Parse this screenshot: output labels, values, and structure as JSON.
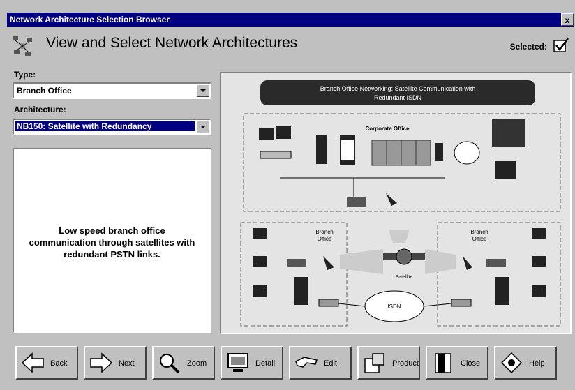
{
  "window": {
    "title": "Network Architecture Selection Browser",
    "close_glyph": "x"
  },
  "header": {
    "title": "View and Select Network Architectures",
    "selected_label": "Selected:"
  },
  "type": {
    "label": "Type:",
    "value": "Branch Office"
  },
  "architecture": {
    "label": "Architecture:",
    "value": "NB150: Satellite with Redundancy"
  },
  "description": "Low speed branch office communication through satellites with redundant PSTN links.",
  "diagram": {
    "banner": [
      "Branch Office Networking: Satellite Communication with",
      "Redundant ISDN"
    ],
    "corporate_office": "Corporate Office",
    "branch_office_left": [
      "Branch",
      "Office"
    ],
    "branch_office_right": [
      "Branch",
      "Office"
    ],
    "isdn": "ISDN",
    "satellite": "Satellite"
  },
  "toolbar": {
    "back": "Back",
    "next": "Next",
    "zoom": "Zoom",
    "detail": "Detail",
    "edit": "Edit",
    "product": "Product",
    "close": "Close",
    "help": "Help"
  }
}
